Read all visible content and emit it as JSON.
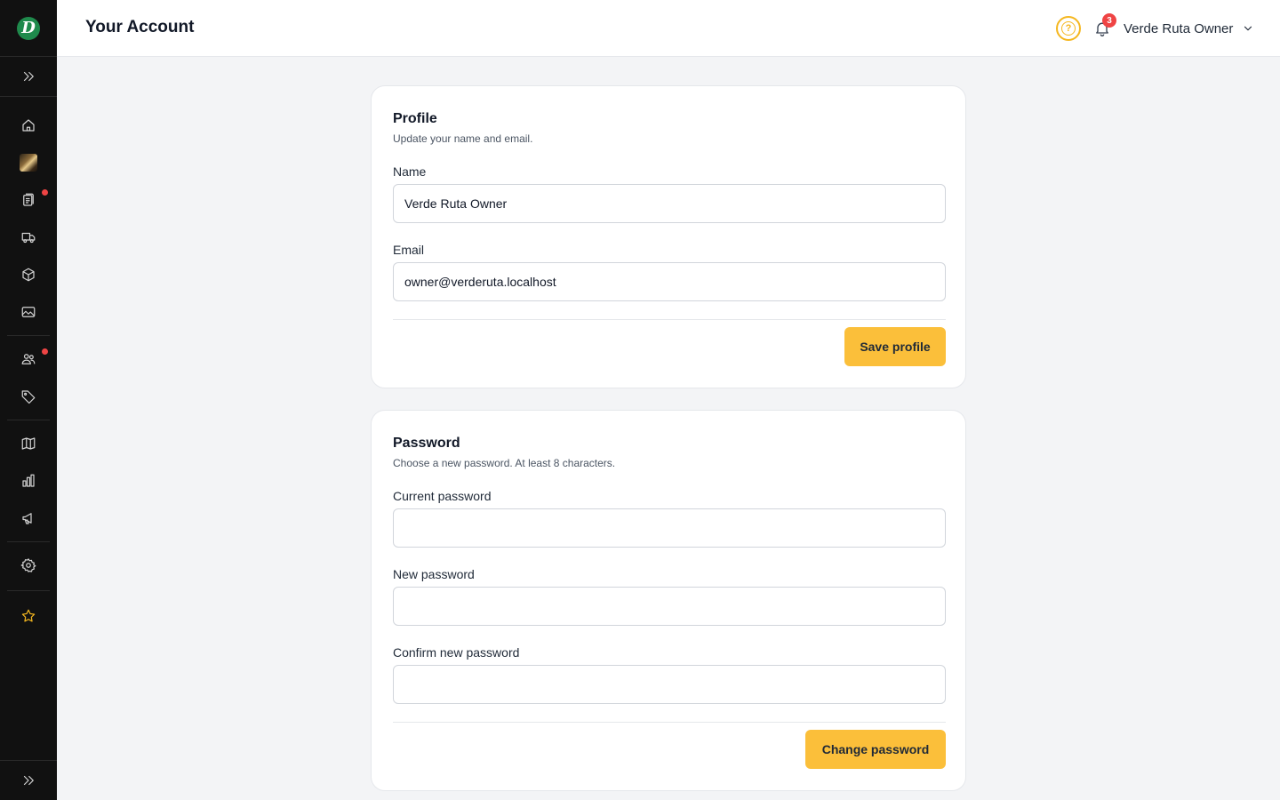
{
  "header": {
    "title": "Your Account",
    "notification_count": "3",
    "user_name": "Verde Ruta Owner"
  },
  "sidebar": {
    "logo_letter": "D",
    "items": [
      {
        "icon": "chevrons-right-icon"
      },
      {
        "icon": "home-icon"
      },
      {
        "icon": "image-thumbnail"
      },
      {
        "icon": "clipboard-icon",
        "has_dot": true
      },
      {
        "icon": "truck-icon"
      },
      {
        "icon": "box-icon"
      },
      {
        "icon": "image-icon"
      },
      {
        "icon": "users-icon",
        "has_dot": true
      },
      {
        "icon": "tag-icon"
      },
      {
        "icon": "map-icon"
      },
      {
        "icon": "chart-icon"
      },
      {
        "icon": "megaphone-icon"
      },
      {
        "icon": "gear-icon"
      },
      {
        "icon": "star-icon"
      },
      {
        "icon": "chevrons-right-icon"
      }
    ]
  },
  "profile": {
    "title": "Profile",
    "subtitle": "Update your name and email.",
    "name_label": "Name",
    "name_value": "Verde Ruta Owner",
    "email_label": "Email",
    "email_value": "owner@verderuta.localhost",
    "save_label": "Save profile"
  },
  "password": {
    "title": "Password",
    "subtitle": "Choose a new password. At least 8 characters.",
    "current_label": "Current password",
    "current_value": "",
    "new_label": "New password",
    "new_value": "",
    "confirm_label": "Confirm new password",
    "confirm_value": "",
    "change_label": "Change password"
  },
  "colors": {
    "accent": "#fbbf3a",
    "sidebar_bg": "#111111",
    "notification": "#ef4444",
    "logo_green": "#1f8a4c"
  }
}
